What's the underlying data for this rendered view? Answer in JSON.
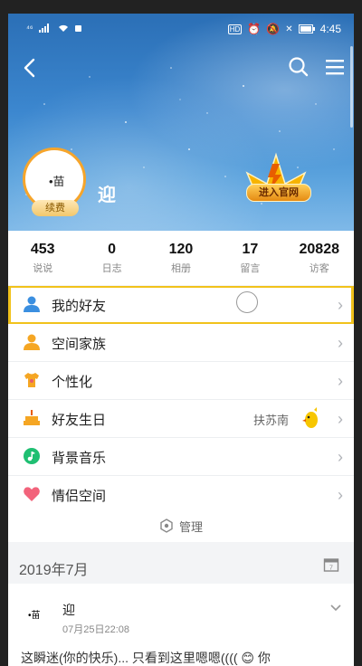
{
  "status_bar": {
    "carrier": "⁴⁶",
    "time": "4:45",
    "badge": "HD"
  },
  "cover": {
    "nickname": "迎",
    "avatar_text": "•苗",
    "renew_label": "续费",
    "vip_button": "进入官网"
  },
  "stats": [
    {
      "value": "453",
      "label": "说说"
    },
    {
      "value": "0",
      "label": "日志"
    },
    {
      "value": "120",
      "label": "相册"
    },
    {
      "value": "17",
      "label": "留言"
    },
    {
      "value": "20828",
      "label": "访客"
    }
  ],
  "menu": [
    {
      "label": "我的好友",
      "icon": "friend-icon",
      "color": "#3b8fe0"
    },
    {
      "label": "空间家族",
      "icon": "family-icon",
      "color": "#f5a623"
    },
    {
      "label": "个性化",
      "icon": "tshirt-icon",
      "color": "#f5a623"
    },
    {
      "label": "好友生日",
      "icon": "cake-icon",
      "color": "#f5a623",
      "side": "扶苏南"
    },
    {
      "label": "背景音乐",
      "icon": "music-icon",
      "color": "#1fbf72"
    },
    {
      "label": "情侣空间",
      "icon": "heart-icon",
      "color": "#f2637b"
    }
  ],
  "manage_label": "管理",
  "date_header": "2019年7月",
  "feed": {
    "name": "迎",
    "avatar_text": "•苗",
    "time": "07月25日22:08",
    "text": "这瞬迷(你的快乐)... 只看到这里嗯嗯(((( 😊 你"
  },
  "colors": {
    "highlight": "#f1c21b",
    "accent": "#f5a623"
  }
}
